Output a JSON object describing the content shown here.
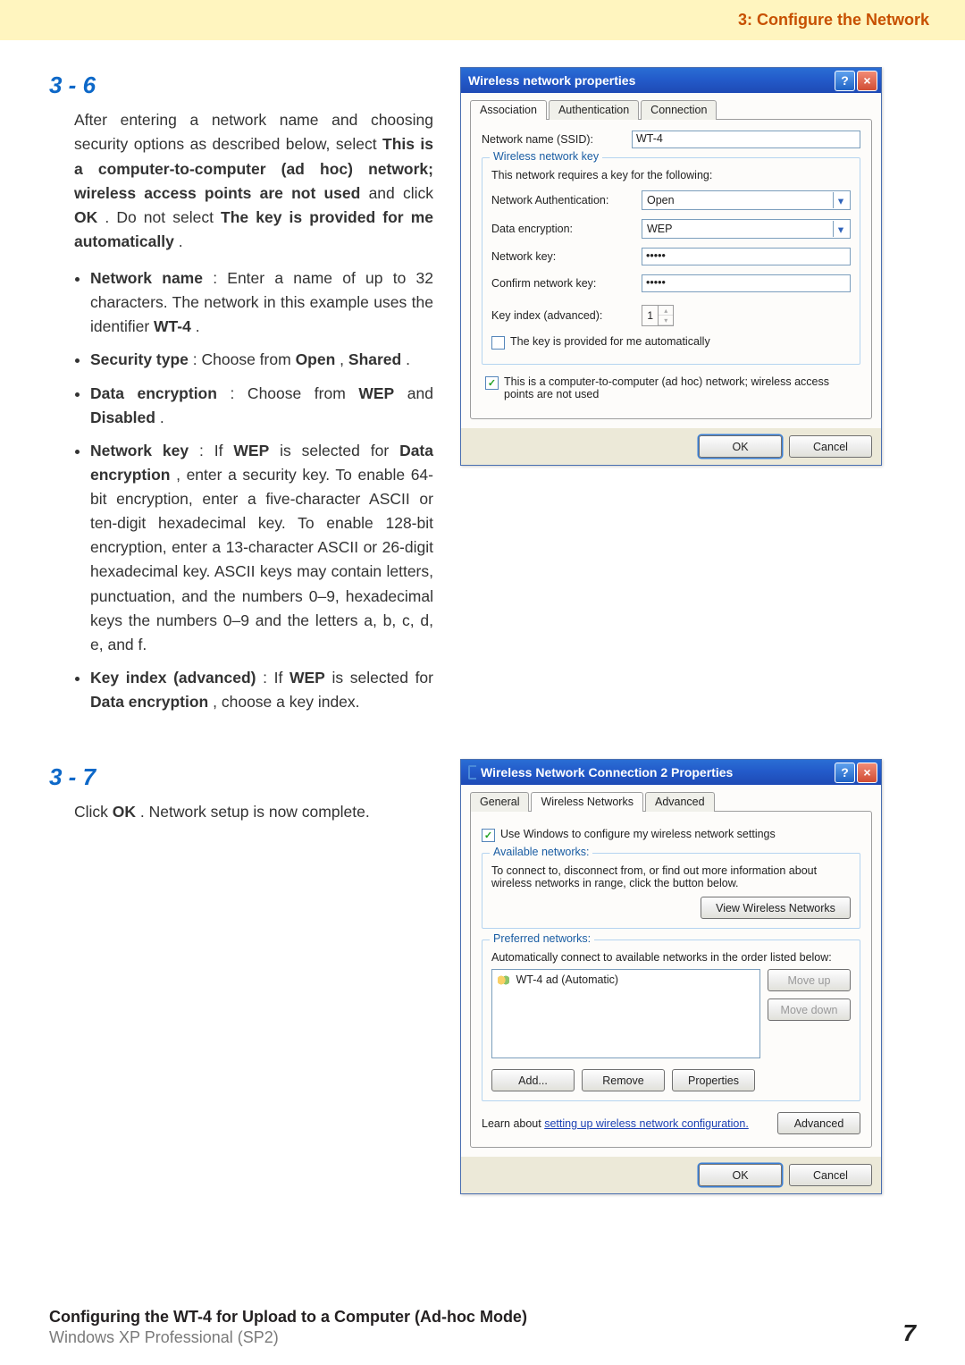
{
  "header": {
    "title": "3: Configure the Network"
  },
  "s36": {
    "heading": "3 - 6",
    "p1_a": "After entering a network name and choosing security options as described below, select ",
    "p1_b": "This is a computer-to-computer (ad hoc) network; wireless access points are not used",
    "p1_c": " and click ",
    "p1_d": "OK",
    "p1_e": ". Do not select ",
    "p1_f": "The key is provided for me automatically",
    "p1_g": ".",
    "b1_a": "Network name",
    "b1_b": ": Enter a name of up to 32 characters. The network in this example uses the identifier ",
    "b1_c": "WT-4",
    "b1_d": ".",
    "b2_a": "Security type",
    "b2_b": ": Choose from ",
    "b2_c": "Open",
    "b2_d": ", ",
    "b2_e": "Shared",
    "b2_f": ".",
    "b3_a": "Data encryption",
    "b3_b": ": Choose from ",
    "b3_c": "WEP",
    "b3_d": " and ",
    "b3_e": "Disabled",
    "b3_f": ".",
    "b4_a": "Network key",
    "b4_b": ": If ",
    "b4_c": "WEP",
    "b4_d": " is selected for ",
    "b4_e": "Data encryption",
    "b4_f": ", enter a security key. To enable 64-bit encryption, enter a five-character ASCII or ten-digit hexadecimal key. To enable 128-bit encryption, enter a 13-character ASCII or 26-digit hexadecimal key. ASCII keys may contain letters, punctuation, and the numbers 0–9, hexadecimal keys the numbers 0–9 and the letters a, b, c, d, e, and f.",
    "b5_a": "Key index (advanced)",
    "b5_b": ": If ",
    "b5_c": "WEP",
    "b5_d": " is selected for ",
    "b5_e": "Data encryption",
    "b5_f": ", choose a key index."
  },
  "dlg1": {
    "title": "Wireless network properties",
    "tabs": {
      "assoc": "Association",
      "auth": "Authentication",
      "conn": "Connection"
    },
    "ssid_label": "Network name (SSID):",
    "ssid_value": "WT-4",
    "fs_legend": "Wireless network key",
    "fs_desc": "This network requires a key for the following:",
    "auth_label": "Network Authentication:",
    "auth_value": "Open",
    "enc_label": "Data encryption:",
    "enc_value": "WEP",
    "key_label": "Network key:",
    "key_value": "•••••",
    "ckey_label": "Confirm network key:",
    "ckey_value": "•••••",
    "kidx_label": "Key index (advanced):",
    "kidx_value": "1",
    "keyauto": "The key is provided for me automatically",
    "adhoc": "This is a computer-to-computer (ad hoc) network; wireless access points are not used",
    "ok": "OK",
    "cancel": "Cancel"
  },
  "s37": {
    "heading": "3 - 7",
    "p1_a": "Click ",
    "p1_b": "OK",
    "p1_c": ". Network setup is now complete."
  },
  "dlg2": {
    "title": "Wireless Network Connection 2 Properties",
    "tabs": {
      "gen": "General",
      "wn": "Wireless Networks",
      "adv": "Advanced"
    },
    "use_win": "Use Windows to configure my wireless network settings",
    "avail_legend": "Available networks:",
    "avail_desc": "To connect to, disconnect from, or find out more information about wireless networks in range, click the button below.",
    "view_btn": "View Wireless Networks",
    "pref_legend": "Preferred networks:",
    "pref_desc": "Automatically connect to available networks in the order listed below:",
    "pref_item": "WT-4 ad (Automatic)",
    "moveup": "Move up",
    "movedown": "Move down",
    "add": "Add...",
    "remove": "Remove",
    "props": "Properties",
    "learn_a": "Learn about ",
    "learn_link": "setting up wireless network configuration.",
    "advanced": "Advanced",
    "ok": "OK",
    "cancel": "Cancel"
  },
  "footer": {
    "line1": "Configuring the WT-4 for Upload to a Computer (Ad-hoc Mode)",
    "line2": "Windows XP Professional (SP2)",
    "page": "7"
  }
}
